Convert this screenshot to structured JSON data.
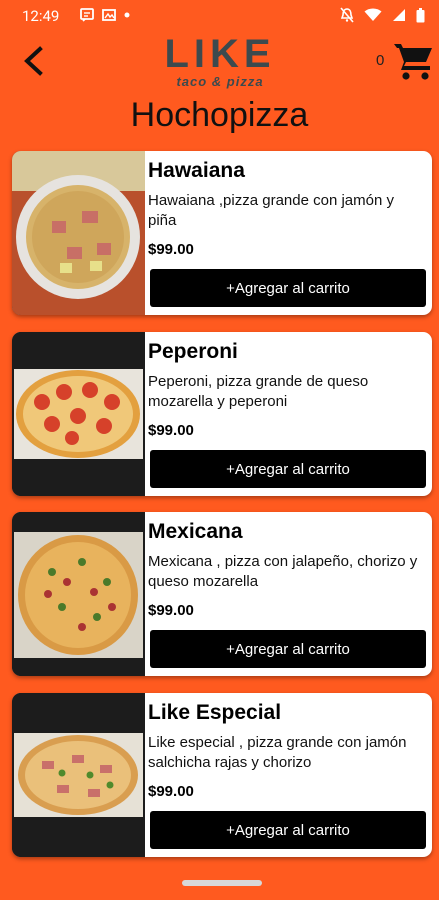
{
  "status_bar": {
    "time": "12:49",
    "left_icons": [
      "message-icon",
      "gallery-icon",
      "dot-icon"
    ],
    "right_icons": [
      "mute-icon",
      "wifi-icon",
      "signal-icon",
      "battery-icon"
    ]
  },
  "header": {
    "back_icon": "arrow-back-icon",
    "logo_title": "LIKE",
    "logo_subtitle": "taco & pizza",
    "cart_count": "0",
    "cart_icon": "shopping-cart-icon"
  },
  "page_title": "Hochopizza",
  "colors": {
    "background": "#ff5a1f",
    "button": "#000000",
    "card": "#ffffff"
  },
  "products": [
    {
      "name": "Hawaiana",
      "description": "Hawaiana ,pizza grande con jamón y piña",
      "price": "$99.00",
      "button": "+Agregar al carrito"
    },
    {
      "name": "Peperoni",
      "description": "Peperoni, pizza grande de queso mozarella y peperoni",
      "price": "$99.00",
      "button": "+Agregar al carrito"
    },
    {
      "name": "Mexicana",
      "description": "Mexicana , pizza con jalapeño, chorizo y queso mozarella",
      "price": "$99.00",
      "button": "+Agregar al carrito"
    },
    {
      "name": "Like Especial",
      "description": "Like especial , pizza grande con jamón salchicha rajas y chorizo",
      "price": "$99.00",
      "button": "+Agregar al carrito"
    }
  ]
}
